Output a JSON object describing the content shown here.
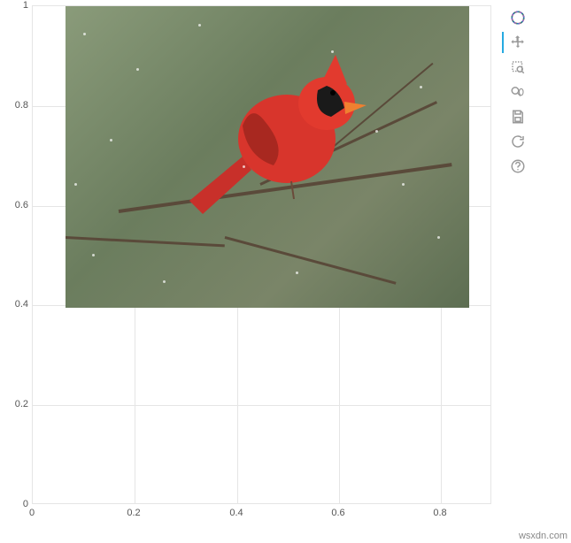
{
  "chart_data": {
    "type": "scatter",
    "title": "",
    "xlabel": "",
    "ylabel": "",
    "xlim": [
      0,
      0.9
    ],
    "ylim": [
      0,
      1
    ],
    "x_ticks": [
      0,
      0.2,
      0.4,
      0.6,
      0.8
    ],
    "y_ticks": [
      0,
      0.2,
      0.4,
      0.6,
      0.8,
      1
    ],
    "image_glyph": {
      "x_extent": [
        0.065,
        0.855
      ],
      "y_extent": [
        0.395,
        1.0
      ],
      "anchor": "bottom-left",
      "description": "Red northern cardinal bird on bare branches in falling snow"
    }
  },
  "axis": {
    "y_labels": [
      "0",
      "0.2",
      "0.4",
      "0.6",
      "0.8",
      "1"
    ],
    "x_labels": [
      "0",
      "0.2",
      "0.4",
      "0.6",
      "0.8"
    ]
  },
  "toolbar": {
    "logo_name": "bokeh-logo-icon",
    "pan_name": "pan-icon",
    "box_zoom_name": "box-zoom-icon",
    "wheel_zoom_name": "wheel-zoom-icon",
    "save_name": "save-icon",
    "reset_name": "reset-icon",
    "help_name": "help-icon"
  },
  "watermark": "wsxdn.com"
}
